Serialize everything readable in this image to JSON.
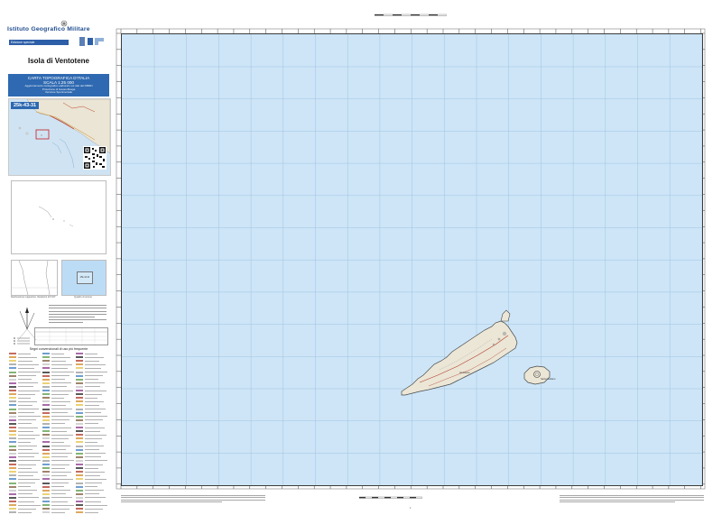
{
  "header": {
    "organization": "Istituto Geografico Militare",
    "organization_sub": "Edizione speciale"
  },
  "map_title": "Isola di Ventotene",
  "series": {
    "line1": "CARTA TOPOGRAFICA D'ITALIA",
    "line2": "SCALA 1:25 000",
    "line3": "Aggiornamento cartografico elaborato sui dati del DBMN",
    "line4": "Proiezione di Gauss-Boaga",
    "line5": "Versione Sperimentale"
  },
  "sheet_number": "25k-43-31",
  "panels": {
    "declination_caption": "Declinazione magnetica: Variazioni di 5.00°",
    "index_caption": "Quadro di unione",
    "index_inner_label": "25k-43-31"
  },
  "legend_title": "Segni convenzionali di uso più frequente",
  "colors": {
    "sea": "#cde5f7",
    "land": "#e8e4d8",
    "header_blue": "#2e69b1",
    "road": "#b23a2a"
  },
  "islands": [
    {
      "name": "Ventotene"
    },
    {
      "name": "Santo Stefano"
    }
  ],
  "page_number": "1"
}
